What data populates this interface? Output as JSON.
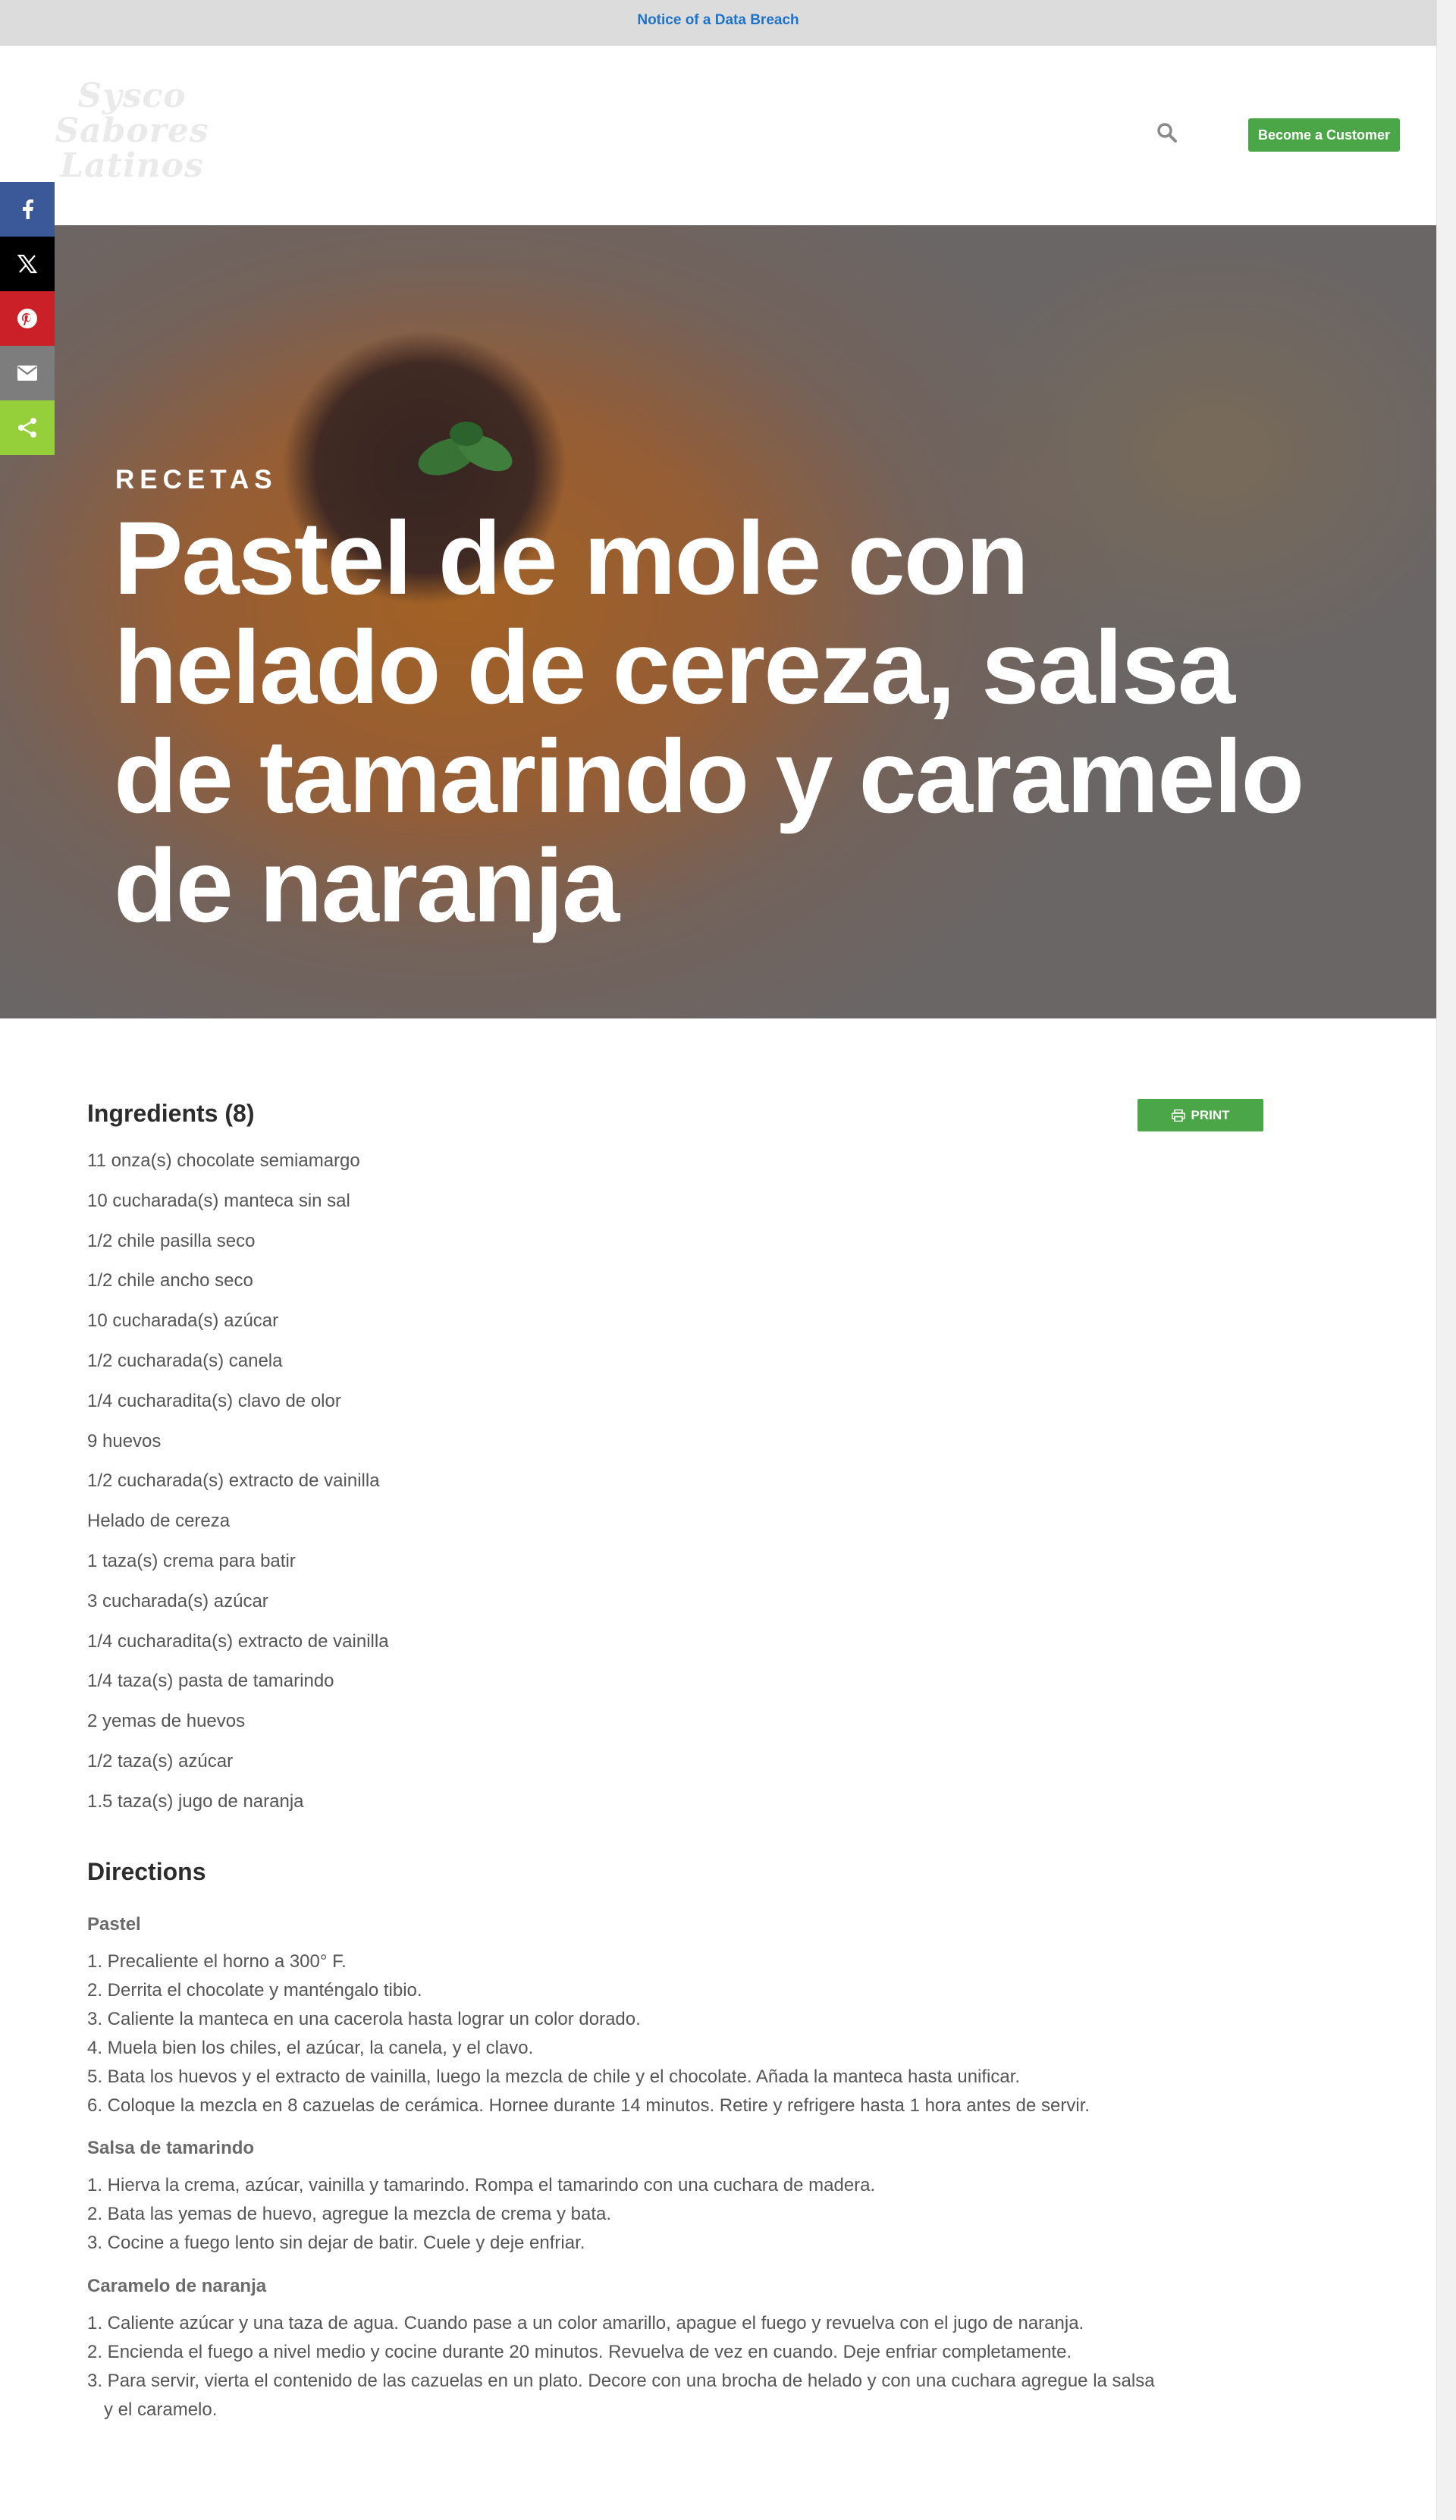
{
  "notice": {
    "text": "Notice of a Data Breach"
  },
  "header": {
    "logo_text": "Sysco Sabores Latinos",
    "search_icon": "search-icon",
    "cta_label": "Become a Customer"
  },
  "share": [
    {
      "name": "facebook-icon",
      "color": "#3b5998"
    },
    {
      "name": "x-icon",
      "color": "#000000"
    },
    {
      "name": "pinterest-icon",
      "color": "#cb2027"
    },
    {
      "name": "email-icon",
      "color": "#7d7d7d"
    },
    {
      "name": "share-icon",
      "color": "#95d03a"
    }
  ],
  "hero": {
    "eyebrow": "RECETAS",
    "title": "Pastel de mole con helado de cereza, salsa de tamarindo y caramelo de naranja"
  },
  "ingredients": {
    "title": "Ingredients (8)",
    "print_label": "PRINT",
    "items": [
      "11 onza(s) chocolate semiamargo",
      "10 cucharada(s) manteca sin sal",
      "1/2 chile pasilla seco",
      "1/2 chile ancho seco",
      "10 cucharada(s) azúcar",
      "1/2 cucharada(s) canela",
      "1/4 cucharadita(s) clavo de olor",
      "9 huevos",
      "1/2 cucharada(s) extracto de vainilla",
      "Helado de cereza",
      "1 taza(s) crema para batir",
      "3 cucharada(s) azúcar",
      "1/4 cucharadita(s) extracto de vainilla",
      "1/4 taza(s) pasta de tamarindo",
      "2 yemas de huevos",
      "1/2 taza(s) azúcar",
      "1.5 taza(s) jugo de naranja"
    ]
  },
  "directions": {
    "title": "Directions",
    "sections": [
      {
        "heading": "Pastel",
        "steps": [
          "1. Precaliente el horno a 300° F.",
          "2. Derrita el chocolate y manténgalo tibio.",
          "3. Caliente la manteca en una cacerola hasta lograr un color dorado.",
          "4. Muela bien los chiles, el azúcar, la canela, y el clavo.",
          "5. Bata los huevos y el extracto de vainilla, luego la mezcla de chile y el chocolate. Añada la manteca hasta unificar.",
          "6. Coloque la mezcla en 8 cazuelas de cerámica. Hornee durante 14 minutos. Retire y refrigere hasta 1 hora antes de servir."
        ]
      },
      {
        "heading": "Salsa de tamarindo",
        "steps": [
          "1. Hierva la crema, azúcar, vainilla y tamarindo. Rompa el tamarindo con una cuchara de madera.",
          "2. Bata las yemas de huevo, agregue la mezcla de crema y bata.",
          "3. Cocine a fuego lento sin dejar de batir. Cuele y deje enfriar."
        ]
      },
      {
        "heading": "Caramelo de naranja",
        "steps": [
          "1. Caliente azúcar y una taza de agua. Cuando pase a un color amarillo, apague el fuego y revuelva con el jugo de naranja.",
          "2. Encienda el fuego a nivel medio y cocine durante 20 minutos. Revuelva de vez en cuando. Deje enfriar completamente.",
          "3. Para servir, vierta el contenido de las cazuelas en un plato. Decore con una brocha de helado y con una cuchara agregue la salsa y el caramelo."
        ]
      }
    ]
  }
}
